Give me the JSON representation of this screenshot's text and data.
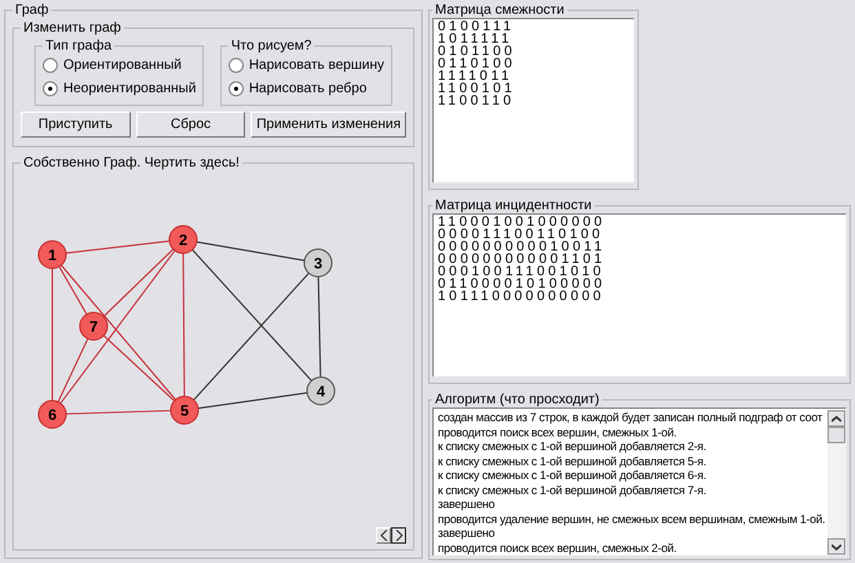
{
  "graph_panel": {
    "title": "Граф",
    "edit_group": {
      "title": "Изменить граф",
      "graph_type": {
        "title": "Тип графа",
        "options": [
          {
            "label": "Ориентированный",
            "selected": false
          },
          {
            "label": "Неориентированный",
            "selected": true
          }
        ]
      },
      "draw_mode": {
        "title": "Что рисуем?",
        "options": [
          {
            "label": "Нарисовать вершину",
            "selected": false
          },
          {
            "label": "Нарисовать ребро",
            "selected": true
          }
        ]
      },
      "buttons": [
        "Приступить",
        "Сброс",
        "Применить изменения"
      ]
    },
    "canvas": {
      "title": "Собственно Граф. Чертить здесь!",
      "nodes": [
        {
          "label": "1",
          "highlighted": true
        },
        {
          "label": "2",
          "highlighted": true
        },
        {
          "label": "3",
          "highlighted": false
        },
        {
          "label": "4",
          "highlighted": false
        },
        {
          "label": "5",
          "highlighted": true
        },
        {
          "label": "6",
          "highlighted": true
        },
        {
          "label": "7",
          "highlighted": true
        }
      ]
    }
  },
  "adjacency_matrix": {
    "title": "Матрица смежности",
    "rows": [
      "0100111",
      "1011111",
      "0101100",
      "0110100",
      "1111011",
      "1100101",
      "1100110"
    ]
  },
  "incidence_matrix": {
    "title": "Матрица инцидентности",
    "rows": [
      "110001001000000",
      "000011100110100",
      "000000000010011",
      "000000000001101",
      "000100111001010",
      "011000010100000",
      "101110000000000"
    ]
  },
  "algorithm_log": {
    "title": "Алгоритм (что просходит)",
    "lines": [
      "создан массив из 7 строк, в каждой будет записан полный подграф от соот",
      "проводится поиск всех вершин, смежных 1-ой.",
      "к списку смежных с 1-ой вершиной добавляется 2-я.",
      "к списку смежных с 1-ой вершиной добавляется 5-я.",
      "к списку смежных с 1-ой вершиной добавляется 6-я.",
      "к списку смежных с 1-ой вершиной добавляется 7-я.",
      "завершено",
      "проводится удаление вершин, не смежных всем вершинам, смежным 1-ой.",
      "завершено",
      "проводится поиск всех вершин, смежных 2-ой."
    ]
  }
}
